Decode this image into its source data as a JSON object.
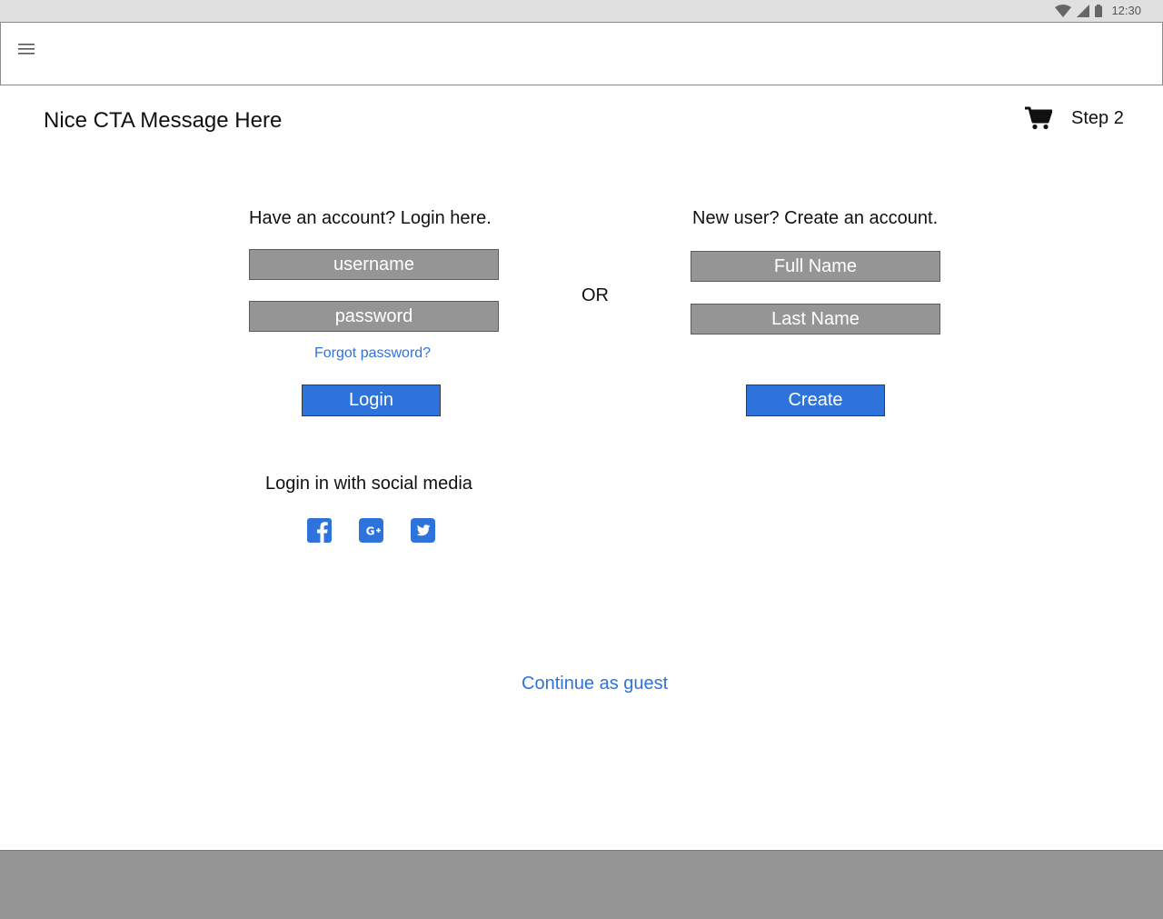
{
  "status_bar": {
    "time": "12:30",
    "icons": [
      "wifi-icon",
      "cell-signal-icon",
      "battery-icon"
    ]
  },
  "app_bar": {
    "menu_icon": "hamburger-menu-icon"
  },
  "header": {
    "cta_title": "Nice CTA Message Here",
    "cart_icon": "shopping-cart-icon",
    "step_label": "Step 2"
  },
  "login": {
    "heading": "Have an account? Login here.",
    "username_placeholder": "username",
    "password_placeholder": "password",
    "forgot_password": "Forgot password?",
    "login_button": "Login"
  },
  "divider": {
    "or_label": "OR"
  },
  "signup": {
    "heading": "New user? Create an account.",
    "full_name_placeholder": "Full Name",
    "last_name_placeholder": "Last Name",
    "create_button": "Create"
  },
  "social": {
    "heading": "Login in with social media",
    "icons": [
      "facebook-icon",
      "google-plus-icon",
      "twitter-icon"
    ]
  },
  "guest": {
    "continue_label": "Continue as guest"
  },
  "colors": {
    "accent": "#2e73dc",
    "field_gray": "#959595",
    "status_bar": "#e0e0e0",
    "footer_gray": "#959595"
  }
}
